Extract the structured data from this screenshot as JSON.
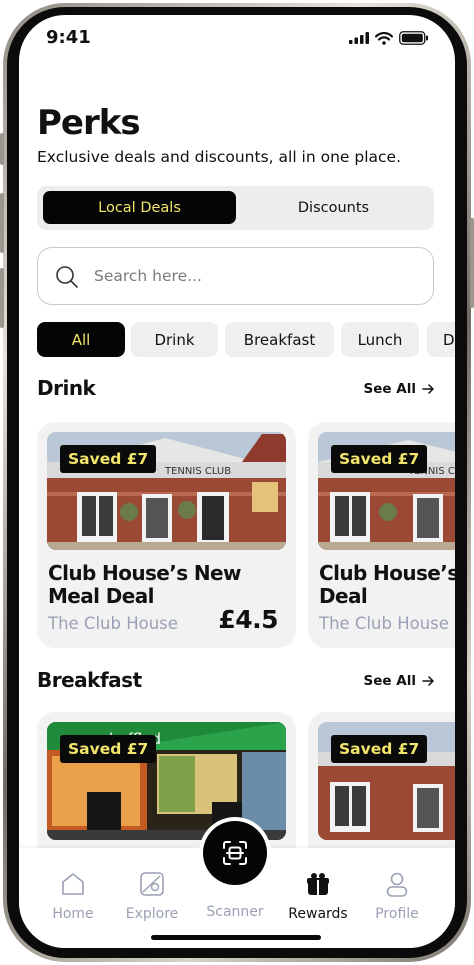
{
  "status_bar": {
    "time": "9:41"
  },
  "header": {
    "title": "Perks",
    "subtitle": "Exclusive deals and discounts, all in one place."
  },
  "segment": {
    "active": "Local Deals",
    "inactive": "Discounts"
  },
  "search": {
    "placeholder": "Search here..."
  },
  "chips": [
    "All",
    "Drink",
    "Breakfast",
    "Lunch",
    "D"
  ],
  "sections": {
    "drink": {
      "title": "Drink",
      "see_all": "See All",
      "cards": [
        {
          "badge": "Saved £7",
          "name": "Club House’s  New Meal Deal",
          "venue": "The Club House",
          "price": "£4.5",
          "image_label": "TENNIS CLUB"
        },
        {
          "badge": "Saved £7",
          "name": "Club House’s Meal Deal",
          "venue": "The Club House",
          "image_label": "TENNIS CLUB"
        }
      ]
    },
    "breakfast": {
      "title": "Breakfast",
      "see_all": "See All",
      "cards": [
        {
          "badge": "Saved £7",
          "image_label": "baffled"
        },
        {
          "badge": "Saved £7"
        }
      ]
    }
  },
  "tabbar": {
    "items": [
      {
        "label": "Home",
        "icon": "home-icon"
      },
      {
        "label": "Explore",
        "icon": "map-icon"
      },
      {
        "label": "Scanner",
        "icon": "scan-icon"
      },
      {
        "label": "Rewards",
        "icon": "gift-icon",
        "active": true
      },
      {
        "label": "Profile",
        "icon": "user-icon"
      }
    ]
  },
  "colors": {
    "accent_yellow": "#f1e56b",
    "black": "#050505",
    "muted": "#9aa1b4"
  }
}
